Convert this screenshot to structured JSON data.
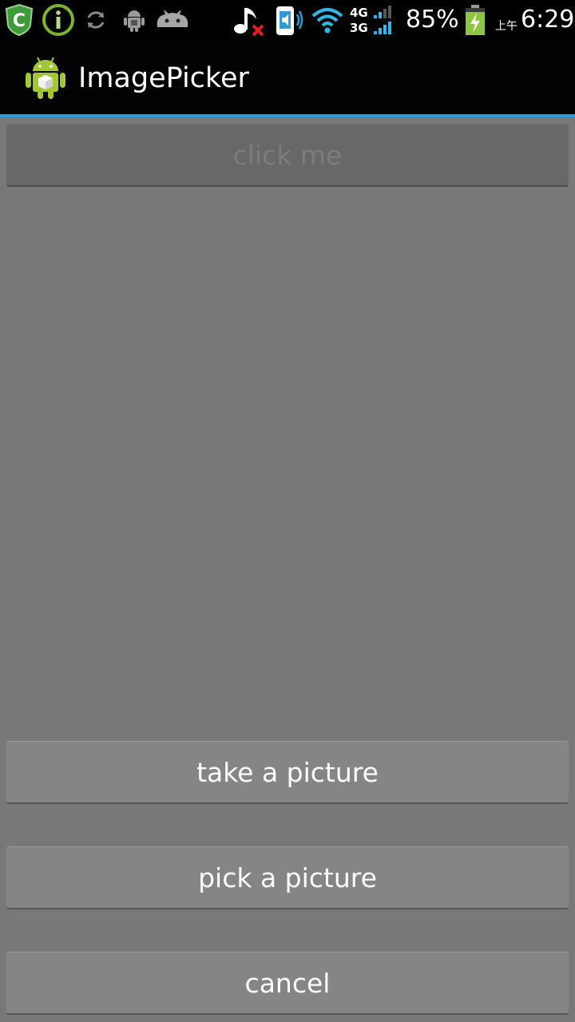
{
  "status_bar": {
    "battery_percent": "85%",
    "time": "6:29",
    "am_pm": "上午",
    "network_top": "4G",
    "network_bottom": "3G",
    "icons": [
      "shield-c-icon",
      "info-icon",
      "sync-icon",
      "android-debug-icon",
      "cloud-bot-icon",
      "music-muted-icon",
      "phone-speaker-icon",
      "wifi-icon",
      "cellular-signal-icon",
      "battery-charging-icon"
    ]
  },
  "action_bar": {
    "title": "ImagePicker",
    "icon": "android-app-icon",
    "accent_color": "#2f9bd3"
  },
  "main": {
    "click_me_label": "click me",
    "click_me_enabled": false
  },
  "sheet": {
    "take_picture_label": "take a picture",
    "pick_picture_label": "pick a picture",
    "cancel_label": "cancel"
  }
}
